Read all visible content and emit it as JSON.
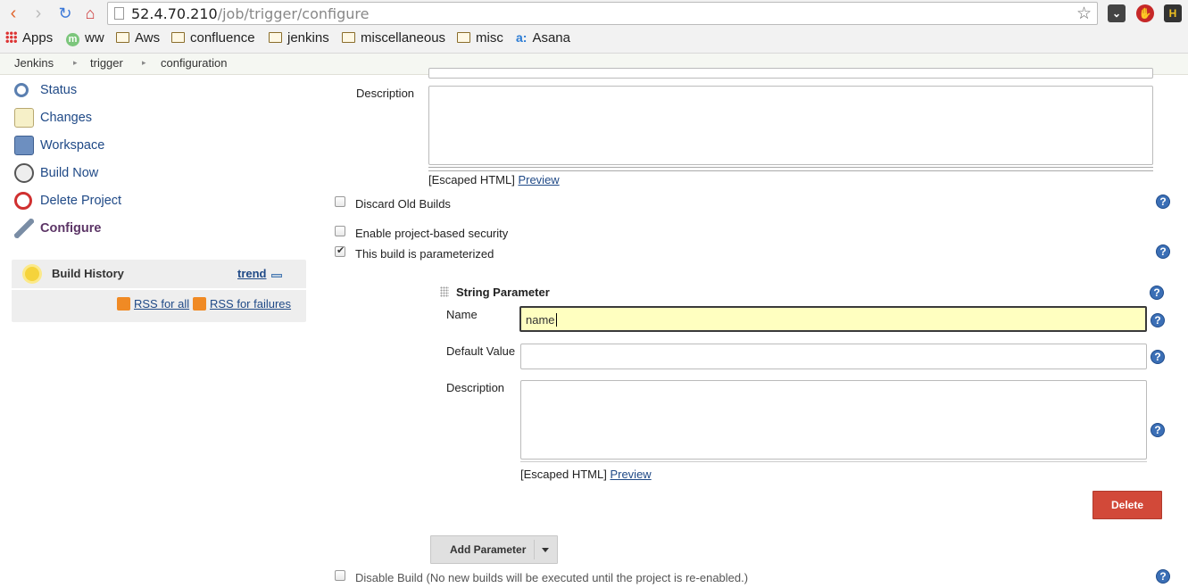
{
  "browser": {
    "url_host": "52.4.70.210",
    "url_path": "/job/trigger/configure",
    "bookmarks": [
      {
        "label": "Apps"
      },
      {
        "label": "ww"
      },
      {
        "label": "Aws"
      },
      {
        "label": "confluence"
      },
      {
        "label": "jenkins"
      },
      {
        "label": "miscellaneous"
      },
      {
        "label": "misc"
      },
      {
        "label": "Asana"
      }
    ]
  },
  "breadcrumbs": [
    "Jenkins",
    "trigger",
    "configuration"
  ],
  "sidebar": {
    "tasks": [
      {
        "label": "Status",
        "icon": "search-icon"
      },
      {
        "label": "Changes",
        "icon": "notepad-icon"
      },
      {
        "label": "Workspace",
        "icon": "folder-icon"
      },
      {
        "label": "Build Now",
        "icon": "clock-play-icon"
      },
      {
        "label": "Delete Project",
        "icon": "no-entry-icon"
      },
      {
        "label": "Configure",
        "icon": "wrench-icon"
      }
    ],
    "build_history": {
      "title": "Build History",
      "trend": "trend",
      "rss_all": "RSS for all",
      "rss_failures": "RSS for failures"
    }
  },
  "config": {
    "description_label": "Description",
    "escaped_html": "[Escaped HTML]",
    "preview": "Preview",
    "options": {
      "discard_old_builds": {
        "label": "Discard Old Builds",
        "checked": false
      },
      "project_security": {
        "label": "Enable project-based security",
        "checked": false
      },
      "parameterized": {
        "label": "This build is parameterized",
        "checked": true
      },
      "disable_build": {
        "label": "Disable Build (No new builds will be executed until the project is re-enabled.)",
        "checked": false
      }
    },
    "string_parameter": {
      "title": "String Parameter",
      "name_label": "Name",
      "name_value": "name",
      "default_label": "Default Value",
      "default_value": "",
      "description_label": "Description",
      "escaped_html": "[Escaped HTML]",
      "preview": "Preview",
      "delete_label": "Delete"
    },
    "add_parameter_label": "Add Parameter",
    "help_glyph": "?"
  }
}
